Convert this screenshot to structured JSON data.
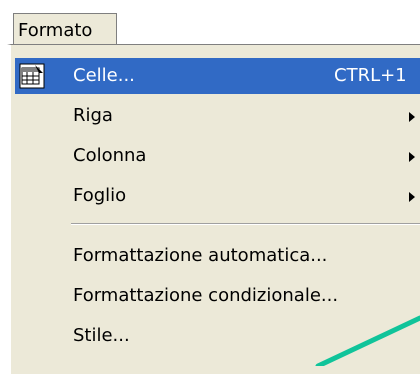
{
  "menubar": {
    "title": "Formato"
  },
  "menu": {
    "items": [
      {
        "label": "Celle...",
        "shortcut": "CTRL+1",
        "icon": "cells-format-icon",
        "selected": true,
        "submenu": false
      },
      {
        "label": "Riga",
        "shortcut": "",
        "submenu": true
      },
      {
        "label": "Colonna",
        "shortcut": "",
        "submenu": true
      },
      {
        "label": "Foglio",
        "shortcut": "",
        "submenu": true
      },
      {
        "label": "Formattazione automatica...",
        "shortcut": "",
        "submenu": false
      },
      {
        "label": "Formattazione condizionale...",
        "shortcut": "",
        "submenu": false
      },
      {
        "label": "Stile...",
        "shortcut": "",
        "submenu": false
      }
    ]
  },
  "colors": {
    "menu_bg": "#ece9d8",
    "selection": "#316ac5",
    "annotation_line": "#10c49a"
  }
}
